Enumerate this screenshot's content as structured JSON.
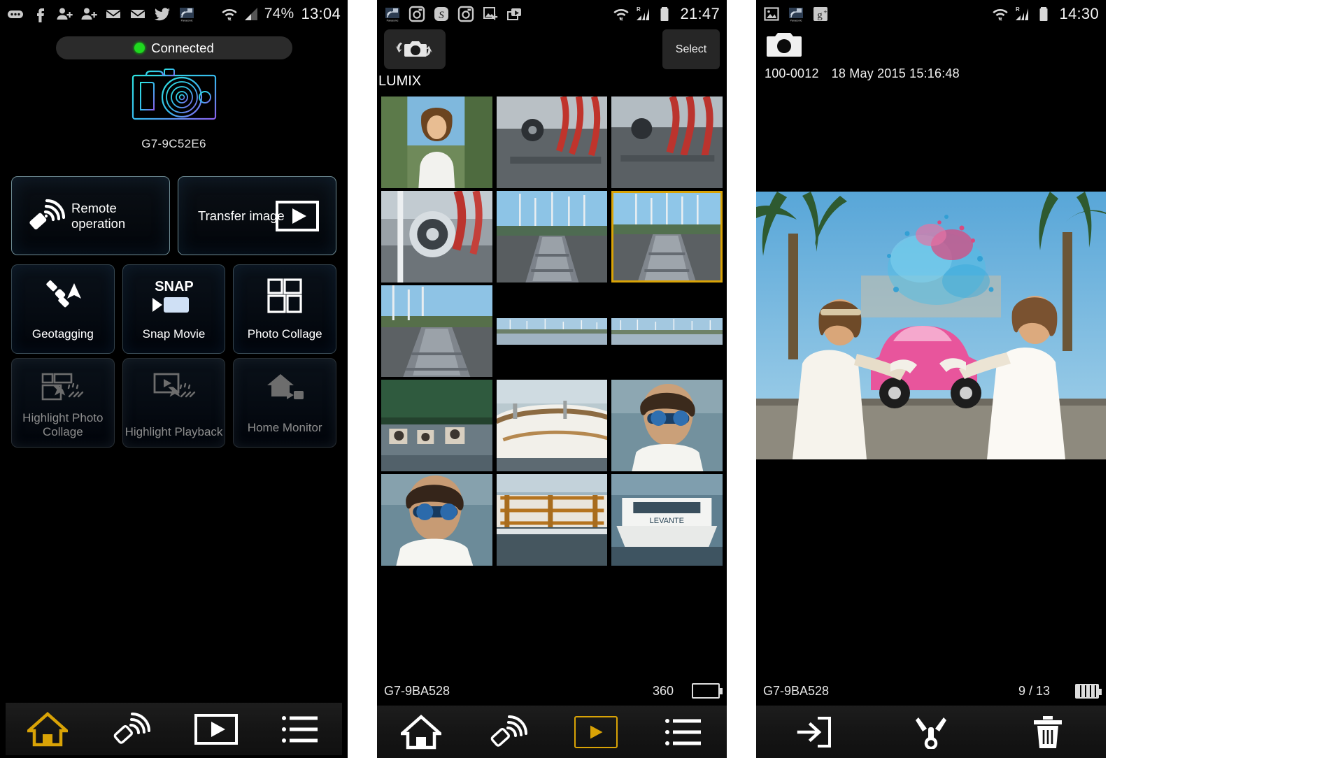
{
  "panel1": {
    "statusbar": {
      "icons": [
        "messages-icon",
        "facebook-icon",
        "add-contact-icon",
        "add-contact-icon",
        "mail-icon",
        "mail-icon",
        "twitter-icon",
        "panasonic-image-app-icon"
      ],
      "wifi": "wifi-icon",
      "signal": "cellular-signal-icon",
      "battery_pct": "74%",
      "time": "13:04"
    },
    "connection": {
      "status": "Connected",
      "dot_color": "#1fd81f"
    },
    "device_name": "G7-9C52E6",
    "primary_buttons": [
      {
        "label": "Remote operation",
        "icon": "remote-wifi-icon"
      },
      {
        "label": "Transfer image",
        "icon": "play-rect-icon"
      }
    ],
    "feature_tiles": [
      {
        "label": "Geotagging",
        "icon": "satellite-icon",
        "enabled": true
      },
      {
        "label": "Snap Movie",
        "icon": "snap-movie-icon",
        "enabled": true
      },
      {
        "label": "Photo Collage",
        "icon": "photo-collage-icon",
        "enabled": true
      },
      {
        "label": "Highlight Photo Collage",
        "icon": "highlight-photo-collage-icon",
        "enabled": false
      },
      {
        "label": "Highlight Playback",
        "icon": "highlight-playback-icon",
        "enabled": false
      },
      {
        "label": "Home Monitor",
        "icon": "home-monitor-icon",
        "enabled": false
      }
    ],
    "nav": [
      {
        "name": "home",
        "icon": "home-icon",
        "selected": true
      },
      {
        "name": "remote",
        "icon": "remote-wifi-icon",
        "selected": false
      },
      {
        "name": "playback",
        "icon": "play-rect-icon",
        "selected": false
      },
      {
        "name": "menu",
        "icon": "list-menu-icon",
        "selected": false
      }
    ],
    "accent": "#d9a306"
  },
  "panel2": {
    "statusbar": {
      "icons": [
        "panasonic-image-app-icon",
        "instagram-icon",
        "skype-icon",
        "instagram-icon",
        "photo-add-icon",
        "video-gallery-icon"
      ],
      "wifi": "wifi-icon",
      "signal": "cellular-signal-roaming-icon",
      "battery": "battery-icon",
      "time": "21:47"
    },
    "camera_select_icon": "camera-switch-icon",
    "select_button": "Select",
    "source_label": "LUMIX",
    "thumbnails": [
      {
        "id": 1,
        "alt": "portrait-woman-beach",
        "selected": false
      },
      {
        "id": 2,
        "alt": "red-rope-boat-deck",
        "selected": false
      },
      {
        "id": 3,
        "alt": "red-rope-boat-deck-2",
        "selected": false
      },
      {
        "id": 4,
        "alt": "pulley-rigging",
        "selected": false
      },
      {
        "id": 5,
        "alt": "boat-deck-marina",
        "selected": false
      },
      {
        "id": 6,
        "alt": "boat-deck-marina-2",
        "selected": true
      },
      {
        "id": 7,
        "alt": "boat-deck-wide",
        "selected": false
      },
      {
        "id": 8,
        "alt": "marina-strip-1",
        "selected": false
      },
      {
        "id": 9,
        "alt": "marina-strip-2",
        "selected": false
      },
      {
        "id": 10,
        "alt": "harbour-awning",
        "selected": false
      },
      {
        "id": 11,
        "alt": "wooden-yacht",
        "selected": false
      },
      {
        "id": 12,
        "alt": "man-sunglasses",
        "selected": false
      },
      {
        "id": 13,
        "alt": "man-sunglasses-2",
        "selected": false
      },
      {
        "id": 14,
        "alt": "boat-hull-closeup",
        "selected": false
      },
      {
        "id": 15,
        "alt": "white-motorboat-levante",
        "selected": false
      }
    ],
    "footer": {
      "device": "G7-9BA528",
      "count": "360",
      "battery_icon": "battery-empty-icon"
    },
    "nav": [
      {
        "name": "home",
        "icon": "home-icon",
        "selected": false
      },
      {
        "name": "remote",
        "icon": "remote-wifi-icon",
        "selected": false
      },
      {
        "name": "playback",
        "icon": "play-rect-icon",
        "selected": true
      },
      {
        "name": "menu",
        "icon": "list-menu-icon",
        "selected": false
      }
    ],
    "accent": "#d9a306"
  },
  "panel3": {
    "statusbar": {
      "icons": [
        "gallery-icon",
        "panasonic-image-app-icon",
        "google-plus-icon"
      ],
      "wifi": "wifi-icon",
      "signal": "cellular-signal-roaming-icon",
      "battery": "battery-icon",
      "time": "14:30"
    },
    "camera_icon": "camera-icon",
    "file_number": "100-0012",
    "timestamp": "18 May 2015 15:16:48",
    "photo_alt": "two-women-colour-powder-pink-car-palms",
    "footer": {
      "device": "G7-9BA528",
      "page": "9 / 13",
      "battery_icon": "battery-full-icon"
    },
    "nav": [
      {
        "name": "save-to-phone",
        "icon": "import-arrow-icon",
        "selected": false
      },
      {
        "name": "share",
        "icon": "share-icon",
        "selected": false
      },
      {
        "name": "delete",
        "icon": "trash-icon",
        "selected": false
      }
    ],
    "accent": "#d9a306"
  }
}
